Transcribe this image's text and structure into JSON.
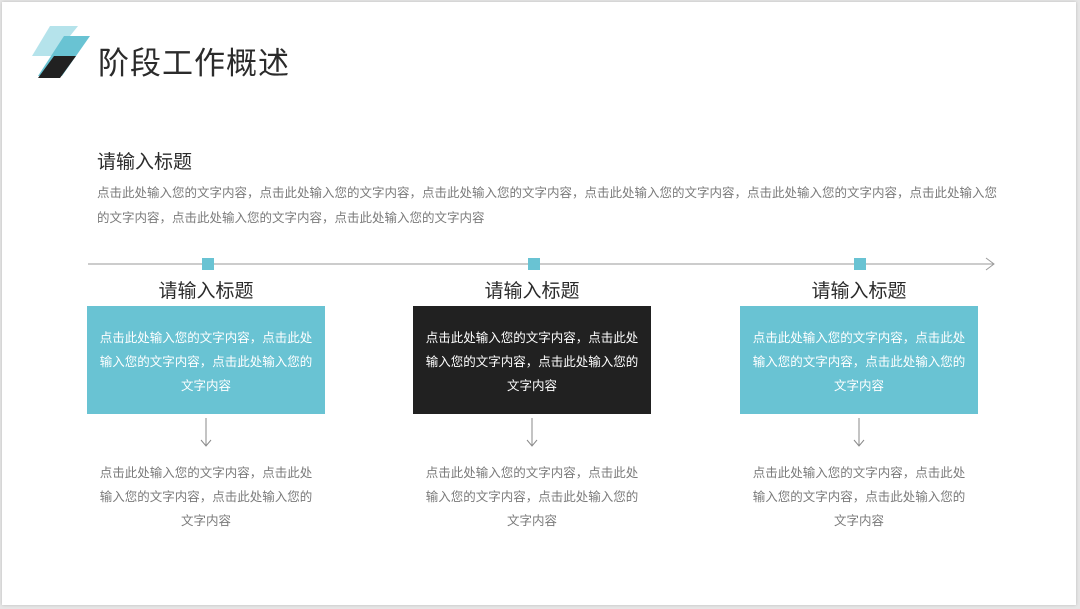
{
  "header": {
    "title": "阶段工作概述"
  },
  "intro": {
    "title": "请输入标题",
    "body": "点击此处输入您的文字内容，点击此处输入您的文字内容，点击此处输入您的文字内容，点击此处输入您的文字内容，点击此处输入您的文字内容，点击此处输入您的文字内容，点击此处输入您的文字内容，点击此处输入您的文字内容"
  },
  "colors": {
    "teal": "#69c3d3",
    "dark": "#212121",
    "line": "#9a9a9a"
  },
  "columns": [
    {
      "title": "请输入标题",
      "box_text": "点击此处输入您的文字内容，点击此处输入您的文字内容，点击此处输入您的文字内容",
      "body": "点击此处输入您的文字内容，点击此处输入您的文字内容，点击此处输入您的文字内容"
    },
    {
      "title": "请输入标题",
      "box_text": "点击此处输入您的文字内容，点击此处输入您的文字内容，点击此处输入您的文字内容",
      "body": "点击此处输入您的文字内容，点击此处输入您的文字内容，点击此处输入您的文字内容"
    },
    {
      "title": "请输入标题",
      "box_text": "点击此处输入您的文字内容，点击此处输入您的文字内容，点击此处输入您的文字内容",
      "body": "点击此处输入您的文字内容，点击此处输入您的文字内容，点击此处输入您的文字内容"
    }
  ]
}
